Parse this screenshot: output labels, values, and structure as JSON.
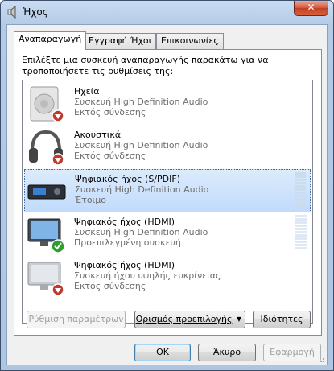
{
  "window": {
    "title": "Ήχος",
    "title_icon": "speaker-icon",
    "close_label": "✕"
  },
  "tabs": [
    {
      "label": "Αναπαραγωγή",
      "active": true
    },
    {
      "label": "Εγγραφή",
      "active": false
    },
    {
      "label": "Ήχοι",
      "active": false
    },
    {
      "label": "Επικοινωνίες",
      "active": false
    }
  ],
  "instruction": "Επιλέξτε μια συσκευή αναπαραγωγής παρακάτω για να τροποποιήσετε τις ρυθμίσεις της:",
  "devices": [
    {
      "name": "Ηχεία",
      "description": "Συσκευή High Definition Audio",
      "status": "Εκτός σύνδεσης",
      "icon": "speakers-icon",
      "badge": "disconnected-icon",
      "selected": false
    },
    {
      "name": "Ακουστικά",
      "description": "Συσκευή High Definition Audio",
      "status": "Εκτός σύνδεσης",
      "icon": "headphones-icon",
      "badge": "disconnected-icon",
      "selected": false
    },
    {
      "name": "Ψηφιακός ήχος (S/PDIF)",
      "description": "Συσκευή High Definition Audio",
      "status": "Έτοιμο",
      "icon": "digital-audio-receiver-icon",
      "badge": "",
      "selected": true
    },
    {
      "name": "Ψηφιακός ήχος (HDMI)",
      "description": "Συσκευή High Definition Audio",
      "status": "Προεπιλεγμένη συσκευή",
      "icon": "monitor-icon",
      "badge": "default-check-icon",
      "selected": false
    },
    {
      "name": "Ψηφιακός ήχος (HDMI)",
      "description": "Συσκευή ήχου υψηλής ευκρίνειας",
      "status": "Εκτός σύνδεσης",
      "icon": "monitor-icon",
      "badge": "disconnected-icon",
      "selected": false
    }
  ],
  "buttons": {
    "configure": "Ρύθμιση παραμέτρων",
    "set_default": "Ορισμός προεπιλογής",
    "properties": "Ιδιότητες",
    "ok": "OK",
    "cancel": "Άκυρο",
    "apply": "Εφαρμογή"
  },
  "colors": {
    "selection": "#c1dbfc",
    "disconnected_badge": "#c0392b",
    "default_badge": "#2e9e2e",
    "secondary_text": "#6d6d6d"
  }
}
